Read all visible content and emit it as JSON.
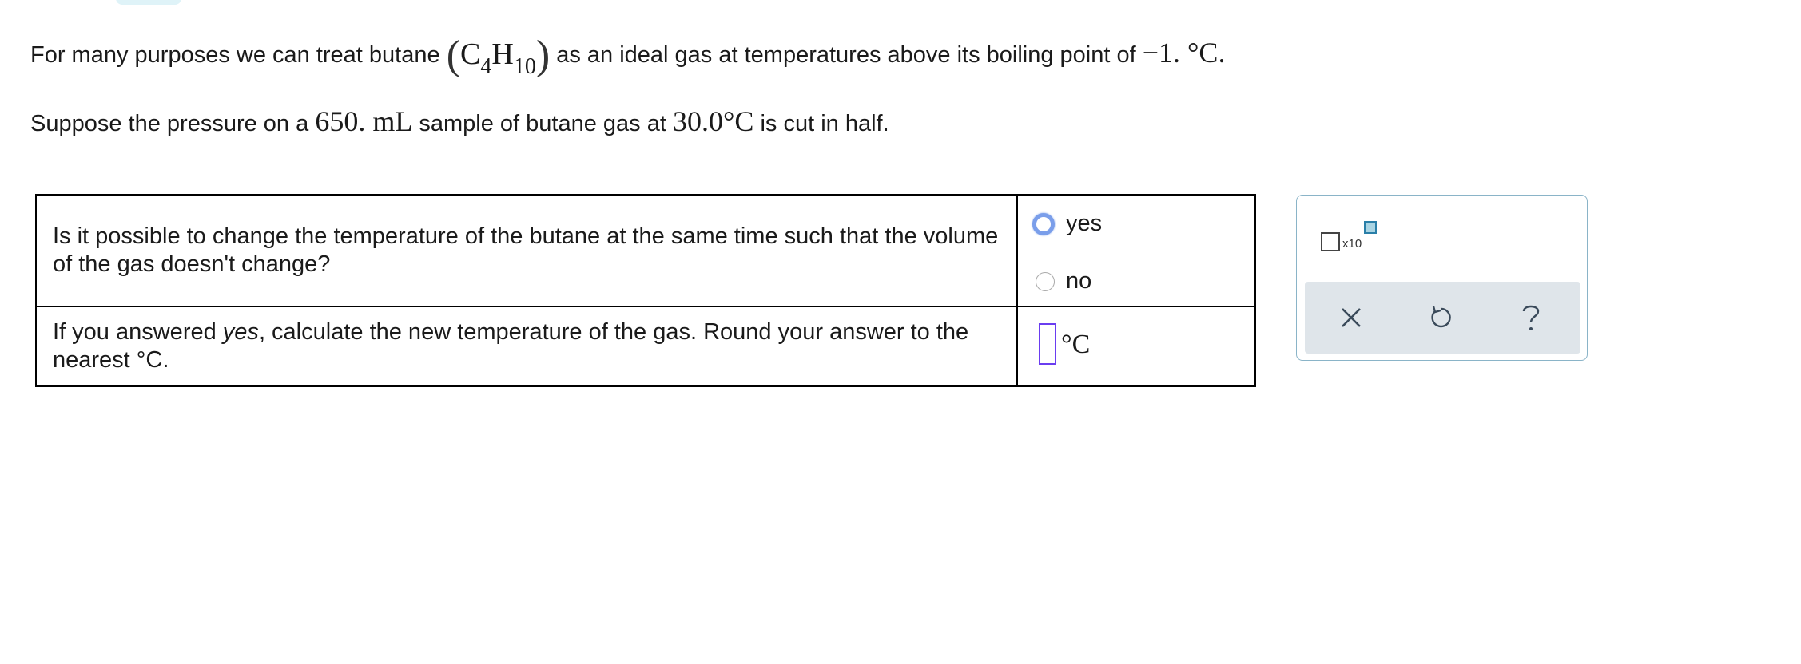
{
  "intro": {
    "prefix": "For many purposes we can treat butane",
    "formula_element1": "C",
    "formula_sub1": "4",
    "formula_element2": "H",
    "formula_sub2": "10",
    "suffix": "as an ideal gas at temperatures above its boiling point of",
    "boiling_point": "−1. °C",
    "end": "."
  },
  "scenario": {
    "prefix": "Suppose the pressure on a",
    "volume": "650. mL",
    "middle": "sample of butane gas at",
    "temperature": "30.0°C",
    "suffix": "is cut in half."
  },
  "questions": [
    {
      "text": "Is it possible to change the temperature of the butane at the same time such that the volume of the gas doesn't change?",
      "options": [
        {
          "label": "yes",
          "selected": true
        },
        {
          "label": "no",
          "selected": false
        }
      ]
    },
    {
      "text_before": "If you answered ",
      "text_emph": "yes",
      "text_after": ", calculate the new temperature of the gas. Round your answer to the nearest °C.",
      "answer_value": "",
      "unit": "°C"
    }
  ],
  "toolbar": {
    "x10_label": "x10",
    "icons": [
      "clear-icon",
      "undo-icon",
      "help-icon"
    ],
    "accent_color": "#2a7fa8",
    "bar_color": "#dfe5ea"
  }
}
